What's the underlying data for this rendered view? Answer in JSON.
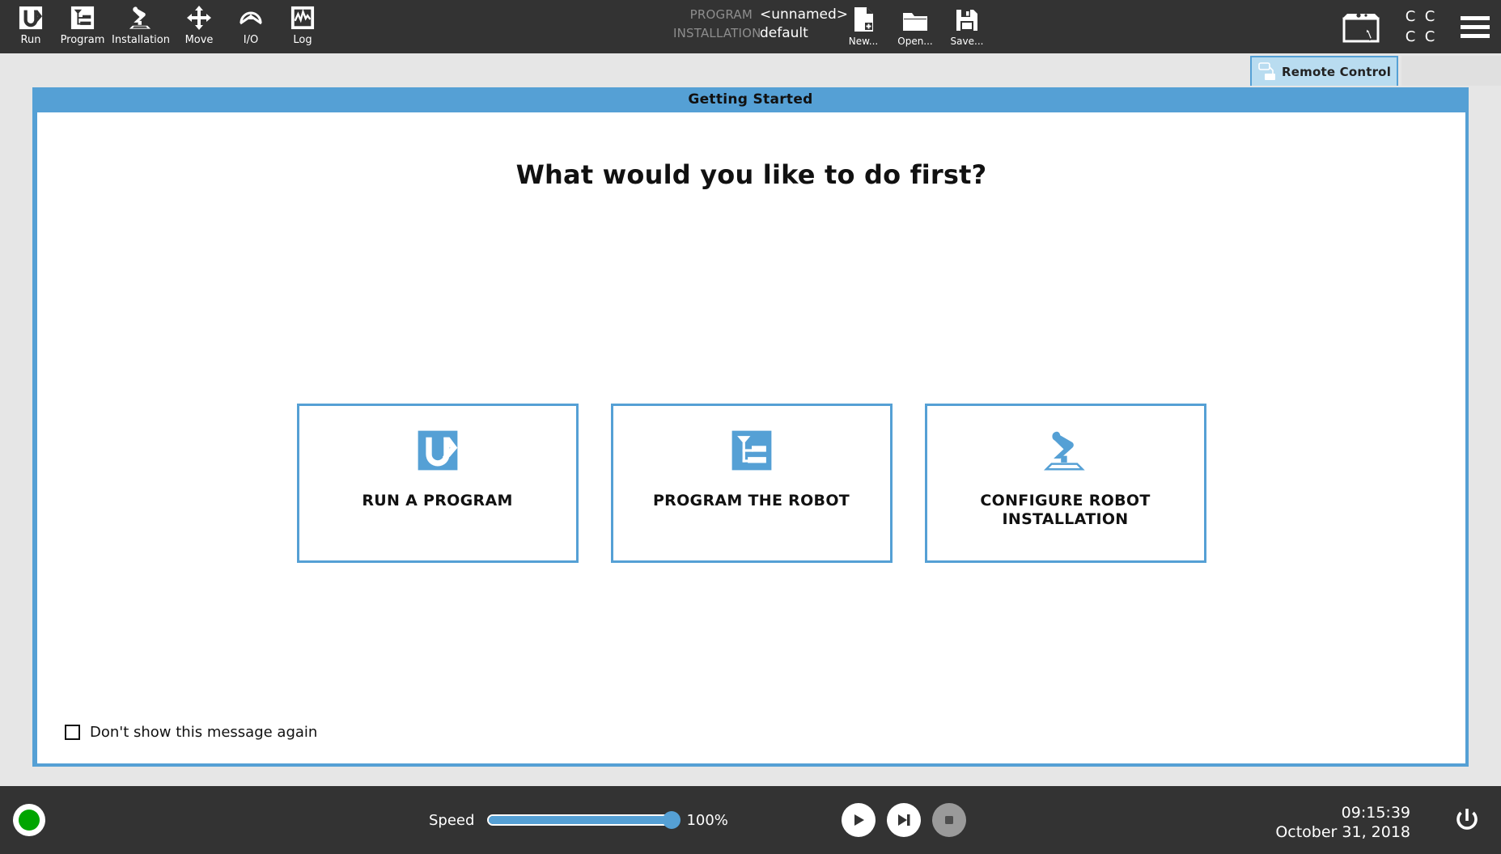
{
  "colors": {
    "accent": "#55a0d5",
    "header_bg": "#333333",
    "panel_bg": "#e6e6e6",
    "tab_active_bg": "#b9dcf0",
    "status_led": "#00a500",
    "text_dark": "#111111",
    "muted_label": "#8d8d8d"
  },
  "header": {
    "nav": [
      {
        "label": "Run",
        "icon": "ur-logo-icon"
      },
      {
        "label": "Program",
        "icon": "program-tree-icon"
      },
      {
        "label": "Installation",
        "icon": "robot-arm-icon"
      },
      {
        "label": "Move",
        "icon": "move-arrows-icon"
      },
      {
        "label": "I/O",
        "icon": "io-gauge-icon"
      },
      {
        "label": "Log",
        "icon": "log-graph-icon"
      }
    ],
    "program": {
      "program_key": "PROGRAM",
      "program_value": "<unnamed>",
      "installation_key": "INSTALLATION",
      "installation_value": "default"
    },
    "file_actions": [
      {
        "label": "New...",
        "icon": "new-file-icon"
      },
      {
        "label": "Open...",
        "icon": "open-folder-icon"
      },
      {
        "label": "Save...",
        "icon": "save-disk-icon"
      }
    ],
    "pendant_icon": "teach-pendant-cursor-icon",
    "cc_grid": [
      "C",
      "C",
      "C",
      "C"
    ],
    "menu_icon": "hamburger-menu-icon"
  },
  "tabs": {
    "active": {
      "label": "Remote Control",
      "icon": "remote-control-device-icon"
    }
  },
  "panel": {
    "title": "Getting Started",
    "heading": "What would you like to do first?",
    "cards": [
      {
        "label": "RUN A PROGRAM",
        "icon": "ur-logo-icon"
      },
      {
        "label": "PROGRAM THE ROBOT",
        "icon": "program-tree-icon"
      },
      {
        "label": "CONFIGURE ROBOT INSTALLATION",
        "icon": "robot-arm-icon"
      }
    ],
    "dont_show": {
      "label": "Don't show this message again",
      "checked": false
    }
  },
  "footer": {
    "status_led": "green",
    "speed": {
      "label": "Speed",
      "value": "100%",
      "percent": 100
    },
    "transport": [
      {
        "name": "play",
        "icon": "play-icon",
        "enabled": true
      },
      {
        "name": "step",
        "icon": "step-icon",
        "enabled": true
      },
      {
        "name": "stop",
        "icon": "stop-icon",
        "enabled": false
      }
    ],
    "clock": {
      "time": "09:15:39",
      "date": "October 31, 2018"
    },
    "power_icon": "power-icon"
  }
}
